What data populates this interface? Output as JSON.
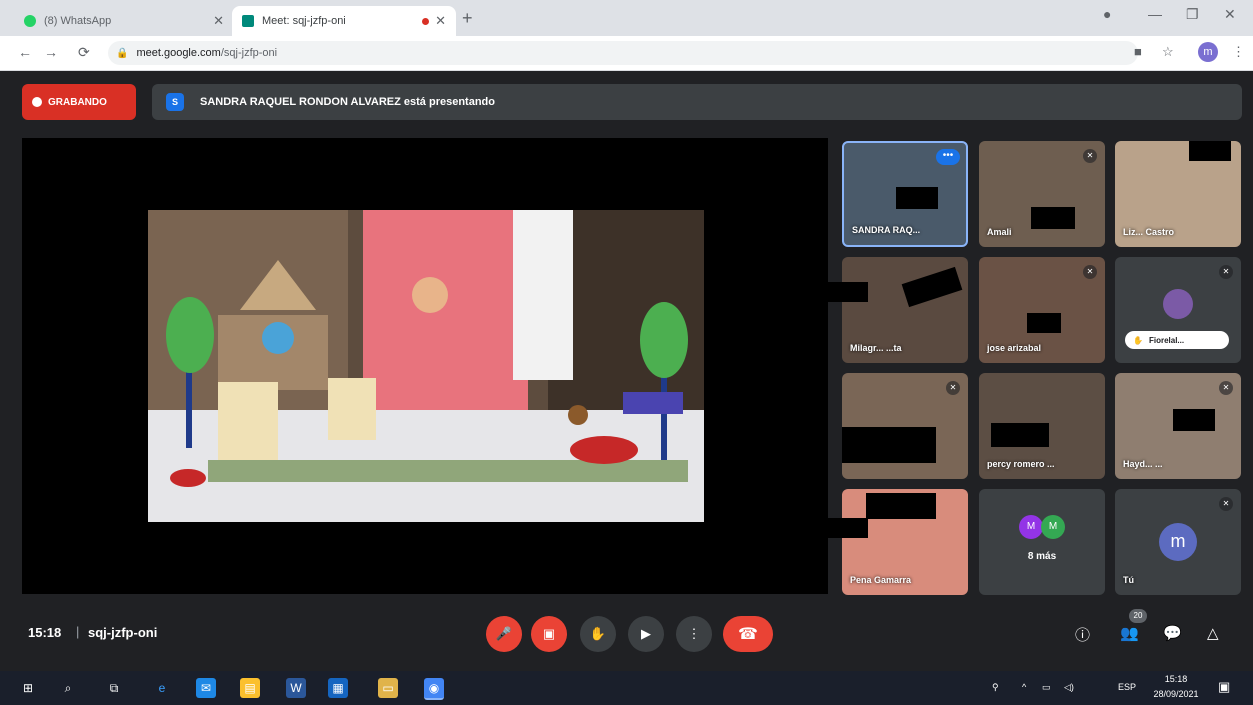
{
  "browser": {
    "tabs": [
      {
        "title": "(8) WhatsApp",
        "active": false
      },
      {
        "title": "Meet: sqj-jzfp-oni",
        "active": true
      }
    ],
    "url_host": "meet.google.com",
    "url_path": "/sqj-jzfp-oni",
    "profile_initial": "m"
  },
  "meet": {
    "recording_label": "GRABANDO",
    "presenter_initial": "S",
    "presenting_text": "SANDRA RAQUEL RONDON ALVAREZ está presentando",
    "participants": [
      {
        "name": "SANDRA RAQ...",
        "muted": false
      },
      {
        "name": "Amali",
        "muted": true
      },
      {
        "name": "Liz... Castro",
        "muted": false
      },
      {
        "name": "Milagr... ...ta",
        "muted": false
      },
      {
        "name": "jose arizabal",
        "muted": true
      },
      {
        "name": "Fiorelal...",
        "muted": true
      },
      {
        "name": "",
        "muted": true
      },
      {
        "name": "percy romero ...",
        "muted": false
      },
      {
        "name": "Hayd... ...",
        "muted": false
      },
      {
        "name": "Pena Gamarra",
        "muted": false
      },
      {
        "name": "8 más",
        "muted": false
      },
      {
        "name": "Tú",
        "muted": true
      }
    ],
    "more_avatars": [
      "M",
      "M"
    ],
    "self_initial": "m",
    "time": "15:18",
    "meeting_code": "sqj-jzfp-oni",
    "participant_count": "20"
  },
  "taskbar": {
    "lang": "ESP",
    "clock_time": "15:18",
    "clock_date": "28/09/2021"
  },
  "colors": {
    "accent_red": "#ea4335",
    "selected_tile_border": "#8ab4f8",
    "meet_bg": "#202124"
  }
}
